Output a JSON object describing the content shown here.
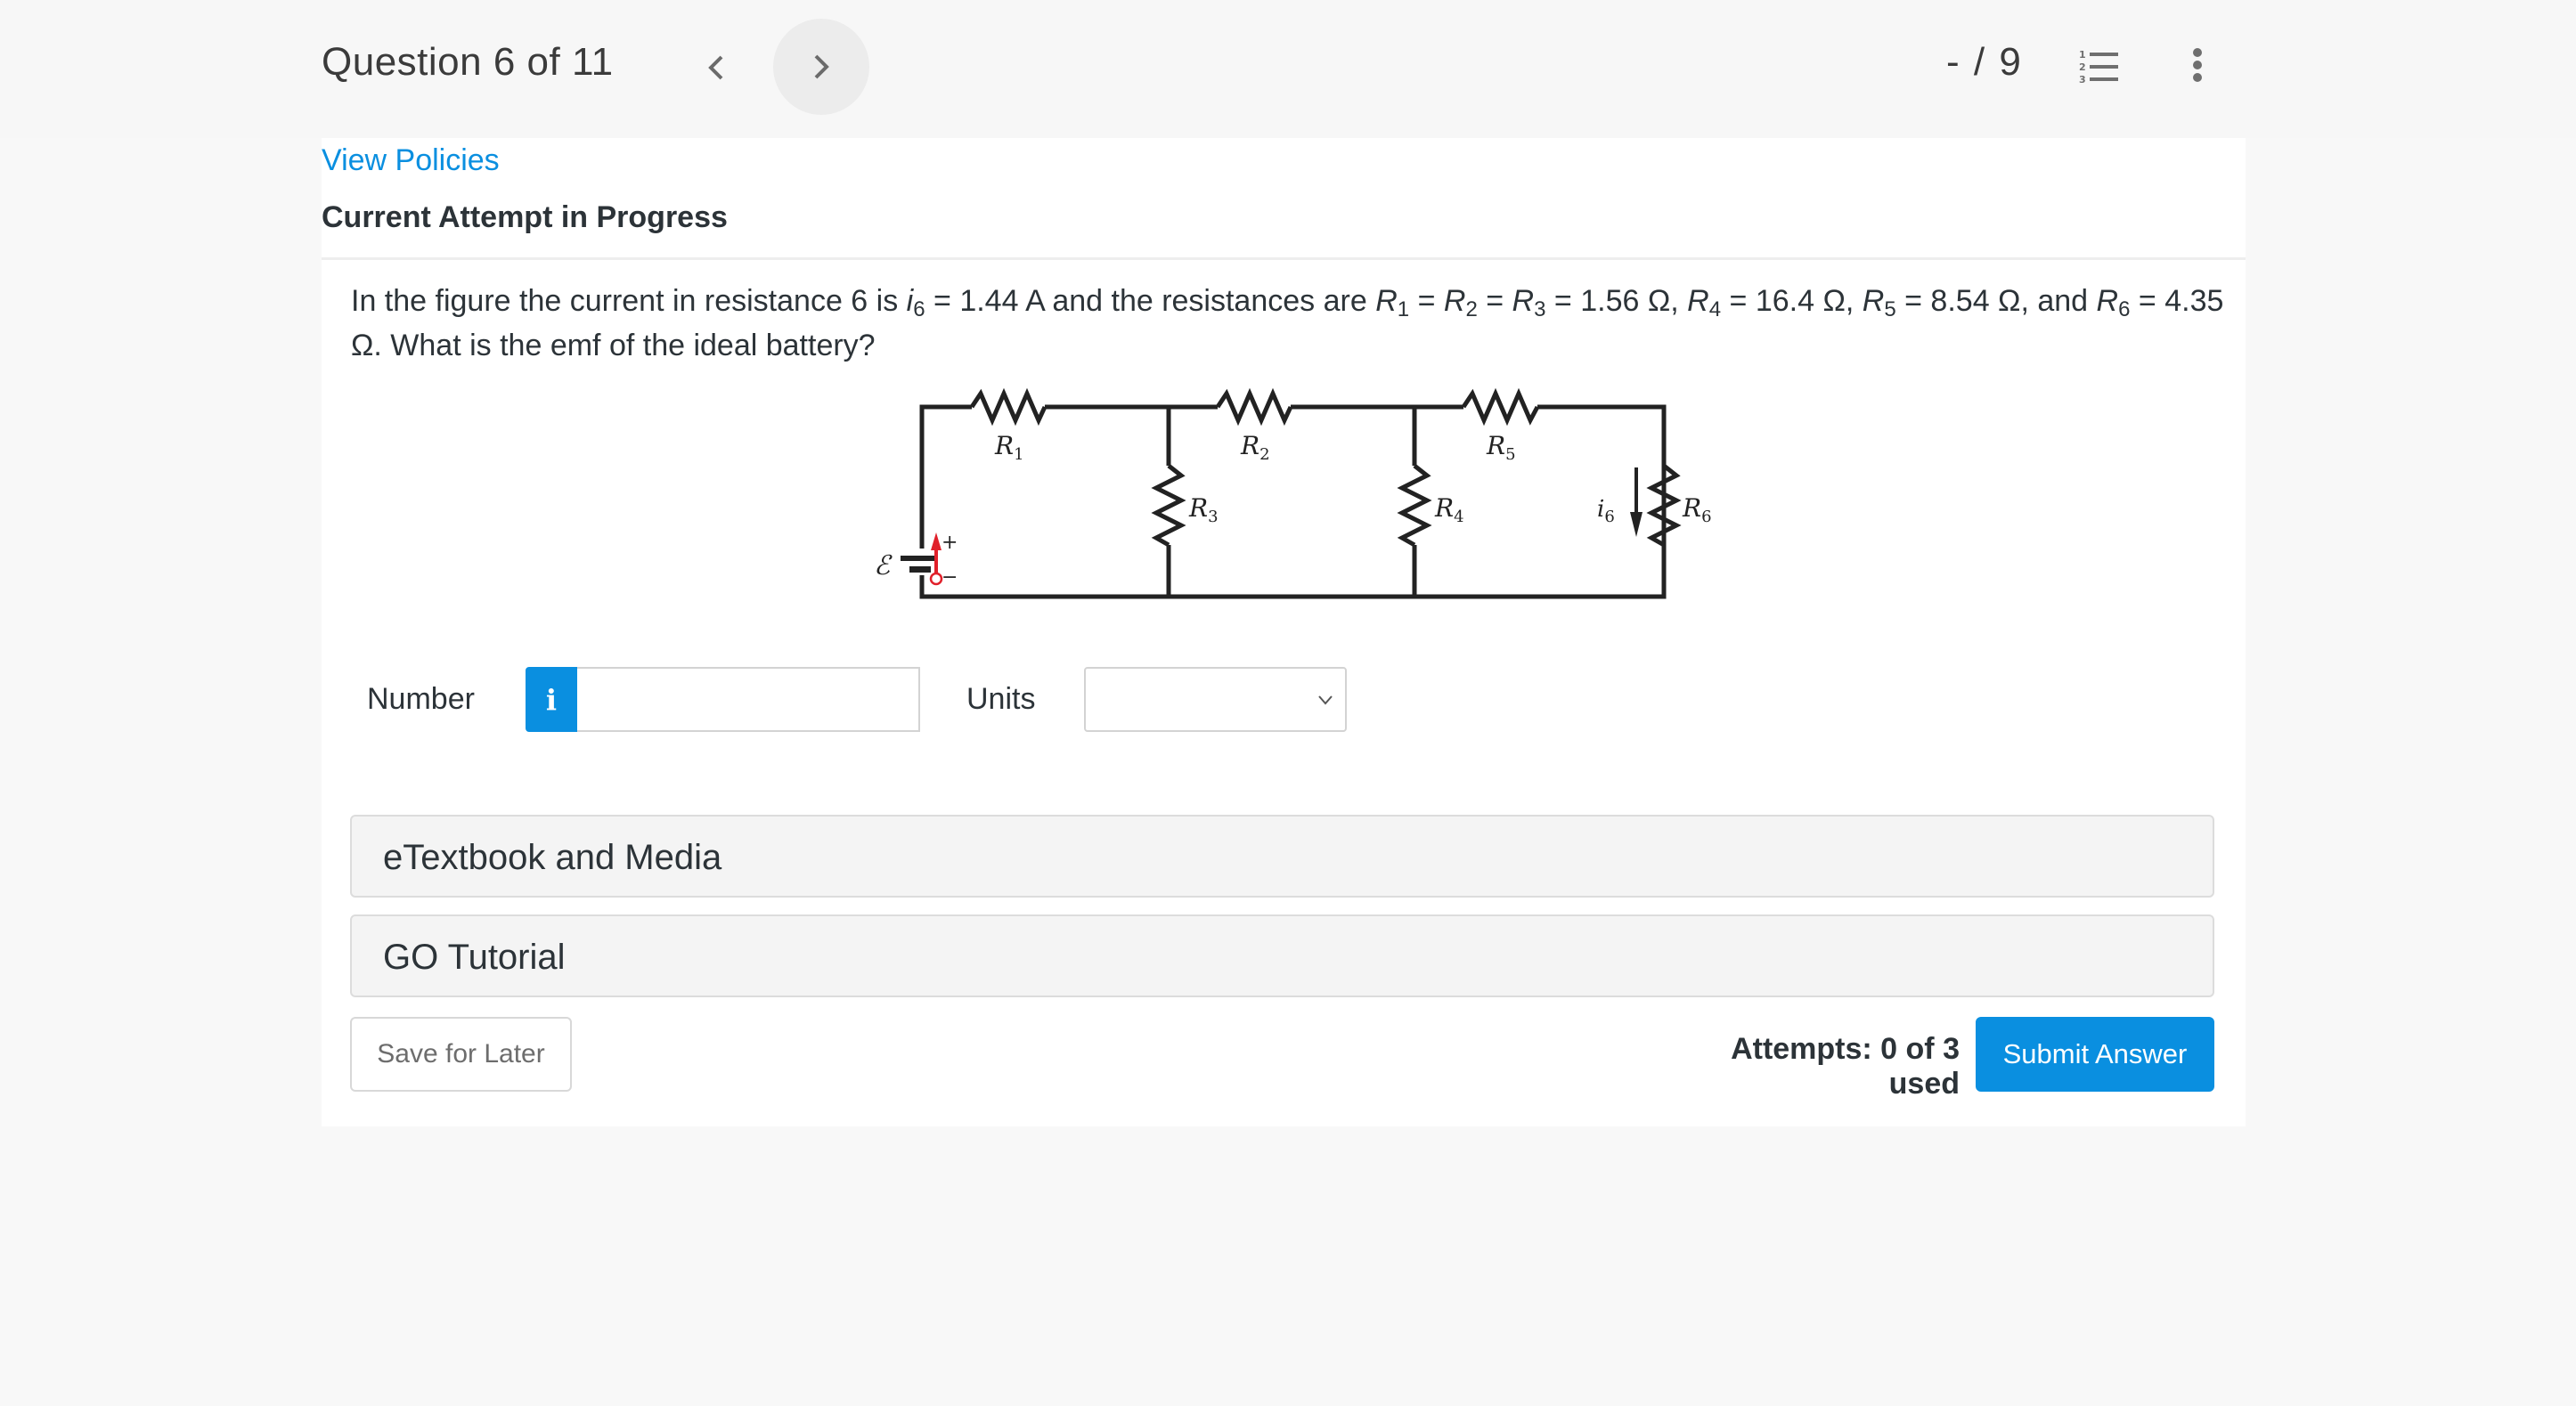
{
  "header": {
    "question_counter": "Question 6 of 11",
    "score": "- / 9",
    "icons": {
      "prev": "chevron-left-icon",
      "next": "chevron-right-icon",
      "question_list": "numbered-list-icon",
      "more": "kebab-menu-icon"
    }
  },
  "card": {
    "view_policies": "View Policies",
    "attempt_heading": "Current Attempt in Progress"
  },
  "question": {
    "line1_prefix": "In the figure the current in resistance 6 is ",
    "i6_symbol": "i",
    "i6_sub": "6",
    "i6_value": " = 1.44 A and the resistances are ",
    "r_symbol": "R",
    "r1_sub": "1",
    "r2_sub": "2",
    "r3_sub": "3",
    "r4_sub": "4",
    "r5_sub": "5",
    "r6_sub": "6",
    "eq": " = ",
    "r123_value": " = 1.56 Ω, ",
    "r4_value": " = 16.4 Ω, ",
    "r5_value": " = 8.54 Ω, and ",
    "r6_value": " = 4.35 Ω. What is the emf of the ideal battery?"
  },
  "figure": {
    "labels": {
      "emf": "ℰ",
      "plus": "+",
      "minus": "−",
      "R1": "R",
      "R1_sub": "1",
      "R2": "R",
      "R2_sub": "2",
      "R3": "R",
      "R3_sub": "3",
      "R4": "R",
      "R4_sub": "4",
      "R5": "R",
      "R5_sub": "5",
      "R6": "R",
      "R6_sub": "6",
      "i6": "i",
      "i6_sub": "6"
    },
    "colors": {
      "wire": "#222222",
      "arrow_red": "#e0202a"
    }
  },
  "answer": {
    "number_label": "Number",
    "info_icon_text": "i",
    "number_value": "",
    "units_label": "Units",
    "units_selected": ""
  },
  "accordions": [
    {
      "label": "eTextbook and Media"
    },
    {
      "label": "GO Tutorial"
    }
  ],
  "footer": {
    "save_label": "Save for Later",
    "attempts": "Attempts: 0 of 3 used",
    "submit_label": "Submit Answer"
  },
  "colors": {
    "accent": "#0a8fe0",
    "header_bg": "#f7f7f7",
    "accordion_bg": "#f4f4f4"
  }
}
